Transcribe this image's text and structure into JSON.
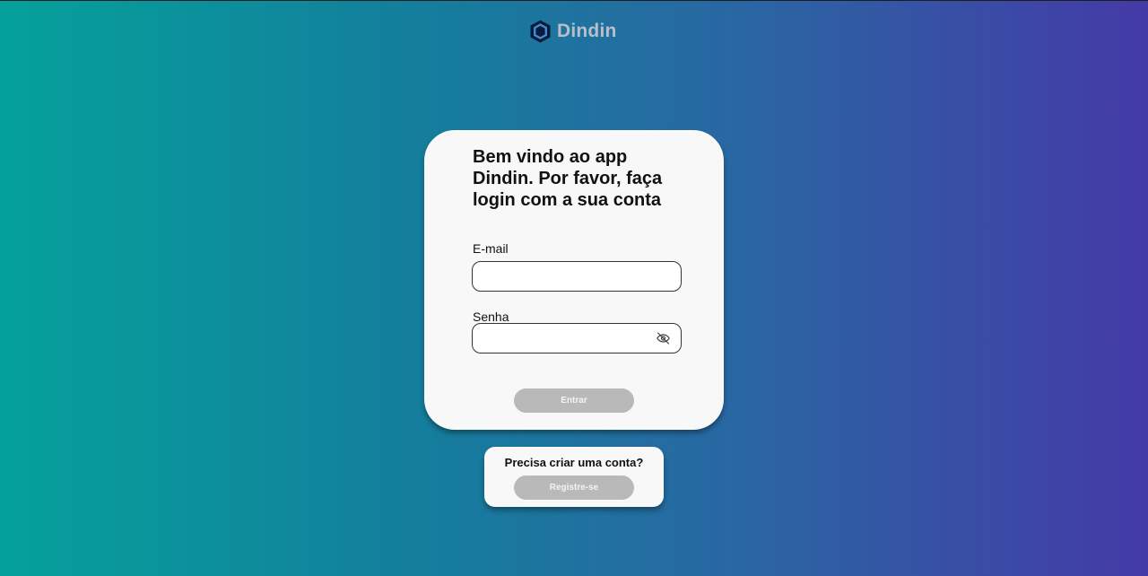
{
  "brand": {
    "name": "Dindin",
    "logo_icon": "hexagon-logo-icon",
    "name_color": "#b8bfc9"
  },
  "login": {
    "title": "Bem vindo ao app Dindin. Por favor, faça login com a sua conta",
    "email_label": "E-mail",
    "email_value": "",
    "password_label": "Senha",
    "password_value": "",
    "password_toggle_icon": "eye-off-icon",
    "submit_label": "Entrar"
  },
  "register": {
    "prompt": "Precisa criar uma conta?",
    "button_label": "Registre-se"
  },
  "colors": {
    "gradient_start": "#05a19b",
    "gradient_end": "#443aa7",
    "button_disabled": "#b9b9b9",
    "card_background": "#f8f8f8"
  }
}
